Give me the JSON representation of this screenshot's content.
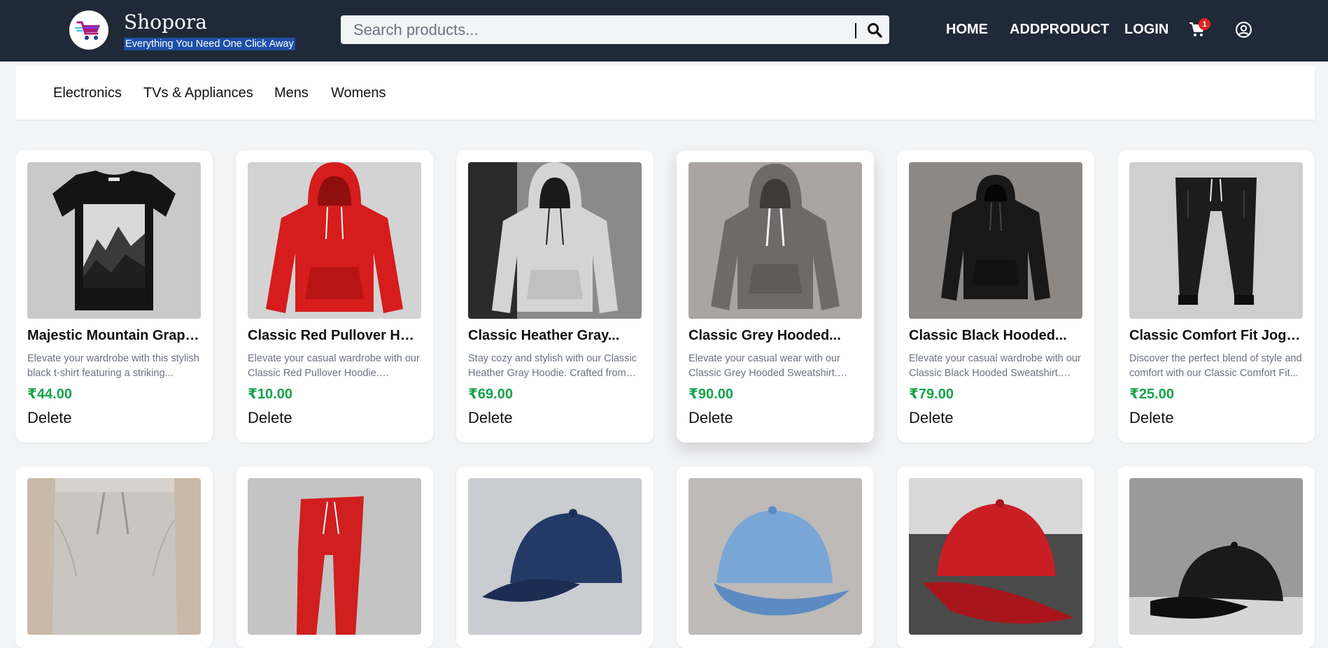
{
  "brand": {
    "name": "Shopora",
    "tagline": "Everything You Need One Click Away"
  },
  "search": {
    "placeholder": "Search products..."
  },
  "nav": {
    "home": "HOME",
    "add_product": "ADDPRODUCT",
    "login": "LOGIN",
    "cart_count": "1"
  },
  "categories": [
    "Electronics",
    "TVs & Appliances",
    "Mens",
    "Womens"
  ],
  "colors": {
    "header_bg": "#1f2937",
    "price": "#16a34a",
    "badge": "#dc2626"
  },
  "products": [
    {
      "title": "Majestic Mountain Graphi...",
      "desc": "Elevate your wardrobe with this stylish black t-shirt featuring a striking...",
      "price": "₹44.00",
      "delete": "Delete",
      "image": "black-tshirt-mountain"
    },
    {
      "title": "Classic Red Pullover Hoodie",
      "desc": "Elevate your casual wardrobe with our Classic Red Pullover Hoodie. Crafted...",
      "price": "₹10.00",
      "delete": "Delete",
      "image": "red-hoodie"
    },
    {
      "title": "Classic Heather Gray...",
      "desc": "Stay cozy and stylish with our Classic Heather Gray Hoodie. Crafted from so...",
      "price": "₹69.00",
      "delete": "Delete",
      "image": "heather-gray-hoodie"
    },
    {
      "title": "Classic Grey Hooded...",
      "desc": "Elevate your casual wear with our Classic Grey Hooded Sweatshirt. Made...",
      "price": "₹90.00",
      "delete": "Delete",
      "image": "grey-hooded-sweatshirt"
    },
    {
      "title": "Classic Black Hooded...",
      "desc": "Elevate your casual wardrobe with our Classic Black Hooded Sweatshirt. Mad...",
      "price": "₹79.00",
      "delete": "Delete",
      "image": "black-hooded-sweatshirt"
    },
    {
      "title": "Classic Comfort Fit Joggers",
      "desc": "Discover the perfect blend of style and comfort with our Classic Comfort Fit...",
      "price": "₹25.00",
      "delete": "Delete",
      "image": "black-joggers"
    }
  ],
  "products_row2": [
    {
      "image": "beige-sweatpants"
    },
    {
      "image": "red-joggers"
    },
    {
      "image": "navy-cap"
    },
    {
      "image": "light-blue-cap"
    },
    {
      "image": "red-cap"
    },
    {
      "image": "black-cap"
    }
  ]
}
